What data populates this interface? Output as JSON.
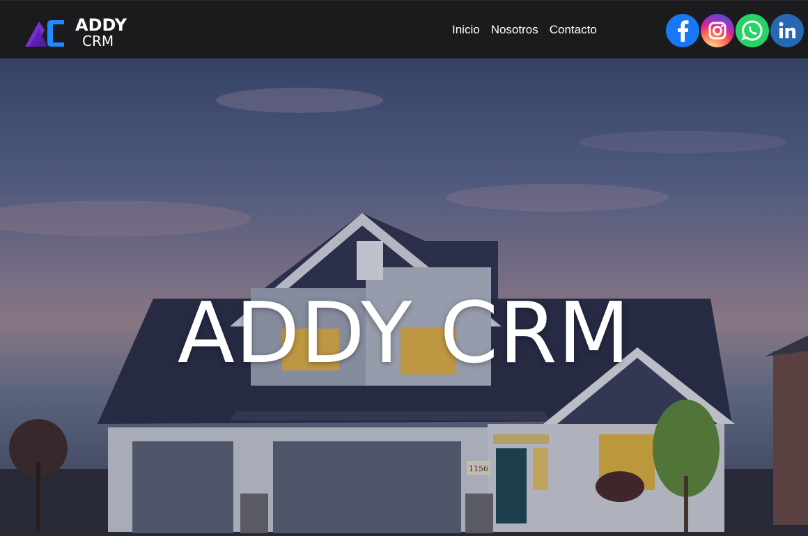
{
  "brand": {
    "name": "ADDY",
    "sub": "CRM"
  },
  "nav": {
    "items": [
      "Inicio",
      "Nosotros",
      "Contacto"
    ]
  },
  "social": {
    "facebook_icon": "facebook-icon",
    "instagram_icon": "instagram-icon",
    "whatsapp_icon": "whatsapp-icon",
    "linkedin_icon": "linkedin-icon"
  },
  "hero": {
    "title": "ADDY CRM",
    "house_number": "1156"
  },
  "colors": {
    "navbar": "#1b1b1d",
    "logo_purple": "#7a2fd6",
    "logo_blue": "#1f8bff",
    "text": "#ffffff"
  }
}
